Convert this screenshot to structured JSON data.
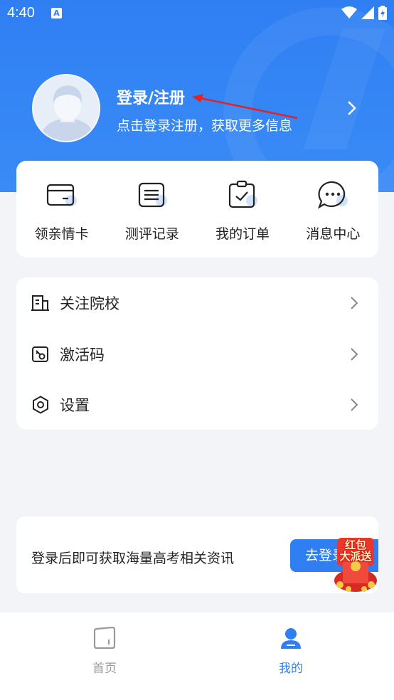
{
  "status_bar": {
    "time": "4:40",
    "notification_badge": "A",
    "icons": [
      "wifi-icon",
      "signal-icon",
      "battery-icon"
    ]
  },
  "profile": {
    "title": "登录/注册",
    "subtitle": "点击登录注册，获取更多信息"
  },
  "quick_actions": [
    {
      "label": "领亲情卡",
      "icon": "card-icon"
    },
    {
      "label": "测评记录",
      "icon": "list-icon"
    },
    {
      "label": "我的订单",
      "icon": "clipboard-check-icon"
    },
    {
      "label": "消息中心",
      "icon": "chat-icon"
    }
  ],
  "menu": [
    {
      "label": "关注院校",
      "icon": "building-icon"
    },
    {
      "label": "激活码",
      "icon": "key-icon"
    },
    {
      "label": "设置",
      "icon": "gear-icon"
    }
  ],
  "promo": {
    "text": "登录后即可获取海量高考相关资讯",
    "button": "去登录",
    "redpack_line1": "红包",
    "redpack_line2": "大派送"
  },
  "tabs": [
    {
      "label": "首页",
      "icon": "home-icon",
      "active": false
    },
    {
      "label": "我的",
      "icon": "user-icon",
      "active": true
    }
  ],
  "colors": {
    "accent": "#2f7ff3",
    "annotation_arrow": "#e02424",
    "inactive_tab": "#999999"
  }
}
